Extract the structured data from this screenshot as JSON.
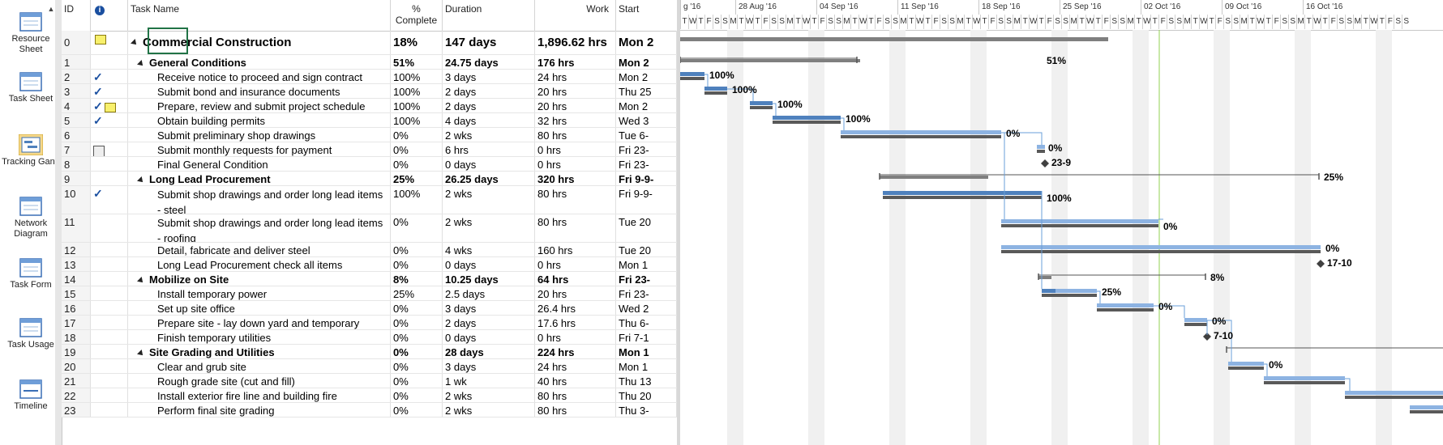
{
  "viewbar": {
    "items": [
      {
        "label": "Resource Sheet",
        "icon": "resource-sheet-icon"
      },
      {
        "label": "Task Sheet",
        "icon": "task-sheet-icon"
      },
      {
        "label": "Tracking Gantt",
        "icon": "tracking-gantt-icon"
      },
      {
        "label": "Network Diagram",
        "icon": "network-diagram-icon"
      },
      {
        "label": "Task Form",
        "icon": "task-form-icon"
      },
      {
        "label": "Task Usage",
        "icon": "task-usage-icon"
      },
      {
        "label": "Timeline",
        "icon": "timeline-icon"
      }
    ]
  },
  "columns": {
    "id": "ID",
    "indicators_icon": "info-icon",
    "name": "Task Name",
    "pct": "% Complete",
    "duration": "Duration",
    "work": "Work",
    "start": "Start"
  },
  "tasks": [
    {
      "id": "0",
      "name": "Commercial Construction",
      "pct": "18%",
      "dur": "147 days",
      "work": "1,896.62 hrs",
      "start": "Mon 2",
      "level": 0,
      "summary": true,
      "ind": "note"
    },
    {
      "id": "1",
      "name": "General Conditions",
      "pct": "51%",
      "dur": "24.75 days",
      "work": "176 hrs",
      "start": "Mon 2",
      "level": 1,
      "summary": true,
      "ind": ""
    },
    {
      "id": "2",
      "name": "Receive notice to proceed and sign contract",
      "pct": "100%",
      "dur": "3 days",
      "work": "24 hrs",
      "start": "Mon 2",
      "level": 2,
      "summary": false,
      "ind": "check"
    },
    {
      "id": "3",
      "name": "Submit bond and insurance documents",
      "pct": "100%",
      "dur": "2 days",
      "work": "20 hrs",
      "start": "Thu 25",
      "level": 2,
      "summary": false,
      "ind": "check"
    },
    {
      "id": "4",
      "name": "Prepare, review and submit project schedule",
      "pct": "100%",
      "dur": "2 days",
      "work": "20 hrs",
      "start": "Mon 2",
      "level": 2,
      "summary": false,
      "ind": "checknote"
    },
    {
      "id": "5",
      "name": "Obtain building permits",
      "pct": "100%",
      "dur": "4 days",
      "work": "32 hrs",
      "start": "Wed 3",
      "level": 2,
      "summary": false,
      "ind": "check"
    },
    {
      "id": "6",
      "name": "Submit preliminary shop drawings",
      "pct": "0%",
      "dur": "2 wks",
      "work": "80 hrs",
      "start": "Tue 6-",
      "level": 2,
      "summary": false,
      "ind": ""
    },
    {
      "id": "7",
      "name": "Submit monthly requests for payment",
      "pct": "0%",
      "dur": "6 hrs",
      "work": "0 hrs",
      "start": "Fri 23-",
      "level": 2,
      "summary": false,
      "ind": "recur"
    },
    {
      "id": "8",
      "name": "Final General Condition",
      "pct": "0%",
      "dur": "0 days",
      "work": "0 hrs",
      "start": "Fri 23-",
      "level": 2,
      "summary": false,
      "ind": ""
    },
    {
      "id": "9",
      "name": "Long Lead Procurement",
      "pct": "25%",
      "dur": "26.25 days",
      "work": "320 hrs",
      "start": "Fri 9-9-",
      "level": 1,
      "summary": true,
      "ind": ""
    },
    {
      "id": "10",
      "name": "Submit shop drawings and order long lead items - steel",
      "pct": "100%",
      "dur": "2 wks",
      "work": "80 hrs",
      "start": "Fri 9-9-",
      "level": 2,
      "summary": false,
      "ind": "check",
      "tall": true
    },
    {
      "id": "11",
      "name": "Submit shop drawings and order long lead items - roofing",
      "pct": "0%",
      "dur": "2 wks",
      "work": "80 hrs",
      "start": "Tue 20",
      "level": 2,
      "summary": false,
      "ind": "",
      "tall": true
    },
    {
      "id": "12",
      "name": "Detail, fabricate and deliver steel",
      "pct": "0%",
      "dur": "4 wks",
      "work": "160 hrs",
      "start": "Tue 20",
      "level": 2,
      "summary": false,
      "ind": ""
    },
    {
      "id": "13",
      "name": "Long Lead Procurement check all items",
      "pct": "0%",
      "dur": "0 days",
      "work": "0 hrs",
      "start": "Mon 1",
      "level": 2,
      "summary": false,
      "ind": ""
    },
    {
      "id": "14",
      "name": "Mobilize on Site",
      "pct": "8%",
      "dur": "10.25 days",
      "work": "64 hrs",
      "start": "Fri 23-",
      "level": 1,
      "summary": true,
      "ind": ""
    },
    {
      "id": "15",
      "name": "Install temporary power",
      "pct": "25%",
      "dur": "2.5 days",
      "work": "20 hrs",
      "start": "Fri 23-",
      "level": 2,
      "summary": false,
      "ind": ""
    },
    {
      "id": "16",
      "name": "Set up site office",
      "pct": "0%",
      "dur": "3 days",
      "work": "26.4 hrs",
      "start": "Wed 2",
      "level": 2,
      "summary": false,
      "ind": ""
    },
    {
      "id": "17",
      "name": "Prepare site - lay down yard and temporary",
      "pct": "0%",
      "dur": "2 days",
      "work": "17.6 hrs",
      "start": "Thu 6-",
      "level": 2,
      "summary": false,
      "ind": ""
    },
    {
      "id": "18",
      "name": "Finish temporary utilities",
      "pct": "0%",
      "dur": "0 days",
      "work": "0 hrs",
      "start": "Fri 7-1",
      "level": 2,
      "summary": false,
      "ind": ""
    },
    {
      "id": "19",
      "name": "Site Grading and Utilities",
      "pct": "0%",
      "dur": "28 days",
      "work": "224 hrs",
      "start": "Mon 1",
      "level": 1,
      "summary": true,
      "ind": ""
    },
    {
      "id": "20",
      "name": "Clear and grub site",
      "pct": "0%",
      "dur": "3 days",
      "work": "24 hrs",
      "start": "Mon 1",
      "level": 2,
      "summary": false,
      "ind": ""
    },
    {
      "id": "21",
      "name": "Rough grade site (cut and fill)",
      "pct": "0%",
      "dur": "1 wk",
      "work": "40 hrs",
      "start": "Thu 13",
      "level": 2,
      "summary": false,
      "ind": ""
    },
    {
      "id": "22",
      "name": "Install exterior fire line and building fire",
      "pct": "0%",
      "dur": "2 wks",
      "work": "80 hrs",
      "start": "Thu 20",
      "level": 2,
      "summary": false,
      "ind": ""
    },
    {
      "id": "23",
      "name": "Perform final site grading",
      "pct": "0%",
      "dur": "2 wks",
      "work": "80 hrs",
      "start": "Thu 3-",
      "level": 2,
      "summary": false,
      "ind": ""
    }
  ],
  "timescale": {
    "weeks": [
      "g '16",
      "28 Aug '16",
      "04 Sep '16",
      "11 Sep '16",
      "18 Sep '16",
      "25 Sep '16",
      "02 Oct '16",
      "09 Oct '16",
      "16 Oct '16"
    ],
    "days": [
      "T",
      "W",
      "T",
      "F",
      "S",
      "S",
      "M",
      "T",
      "W",
      "T",
      "F",
      "S",
      "S",
      "M",
      "T",
      "W",
      "T",
      "F",
      "S",
      "S",
      "M",
      "T",
      "W",
      "T",
      "F",
      "S",
      "S",
      "M",
      "T",
      "W",
      "T",
      "F",
      "S",
      "S",
      "M",
      "T",
      "W",
      "T",
      "F",
      "S",
      "S",
      "M",
      "T",
      "W",
      "T",
      "F",
      "S",
      "S",
      "M",
      "T",
      "W",
      "T",
      "F",
      "S",
      "S",
      "M",
      "T",
      "W",
      "T",
      "F",
      "S",
      "S",
      "M",
      "T",
      "W",
      "T",
      "F",
      "S",
      "S",
      "M",
      "T",
      "W",
      "T",
      "F",
      "S",
      "S",
      "M",
      "T",
      "W",
      "T",
      "F",
      "S",
      "S",
      "M",
      "T",
      "W",
      "T",
      "F",
      "S",
      "S"
    ]
  },
  "gantt_labels": {
    "r1": "51%",
    "r2": "100%",
    "r3": "100%",
    "r4": "100%",
    "r5": "100%",
    "r6": "0%",
    "r7": "0%",
    "r8": "23-9",
    "r9": "25%",
    "r10": "100%",
    "r11": "0%",
    "r12": "0%",
    "r13": "17-10",
    "r14": "8%",
    "r15": "25%",
    "r16": "0%",
    "r17": "0%",
    "r18": "7-10",
    "r20": "0%"
  },
  "colors": {
    "actual": "#4f81bd",
    "planned_bar": "#8db3e2",
    "baseline": "#595959",
    "summary": "#7f7f7f",
    "status_line": "#92d050"
  }
}
